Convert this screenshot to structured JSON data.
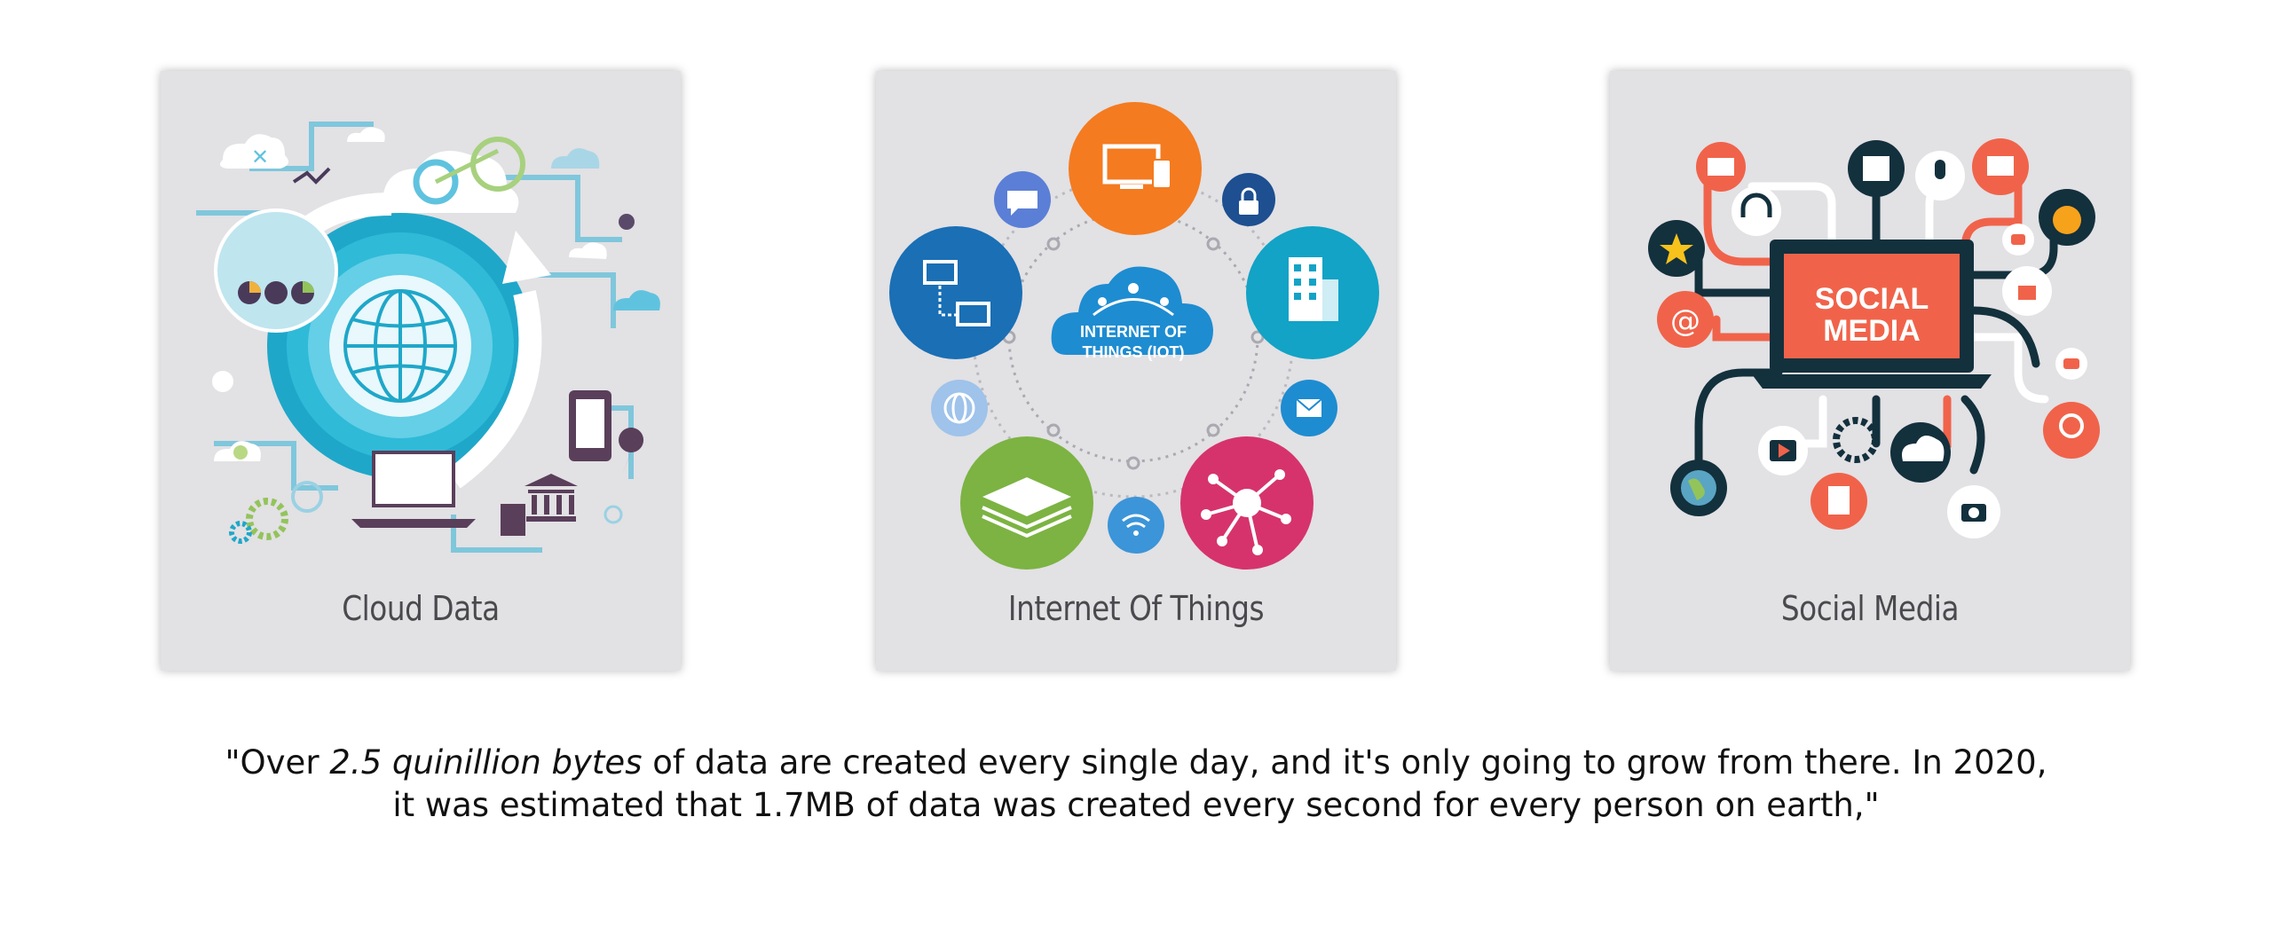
{
  "cards": [
    {
      "label": "Cloud Data",
      "icon": "cloud-data-illustration"
    },
    {
      "label": "Internet Of Things",
      "icon": "iot-illustration",
      "center_text_1": "INTERNET OF",
      "center_text_2": "THINGS (IOT)"
    },
    {
      "label": "Social Media",
      "icon": "social-media-illustration",
      "screen_text_1": "SOCIAL",
      "screen_text_2": "MEDIA"
    }
  ],
  "quote": {
    "open": "\"Over ",
    "emphasis": "2.5 quinillion bytes",
    "line1_rest": " of data are created every single day, and it's only going to grow from there. In 2020,",
    "line2": "it was estimated that 1.7MB of data was created every second for every person on earth,\""
  },
  "colors": {
    "card_bg": "#e2e1e4",
    "iot_orange": "#f47b20",
    "iot_blue": "#1a6fb5",
    "iot_teal": "#12a3c6",
    "iot_green": "#7cb342",
    "iot_pink": "#d6336c",
    "social_coral": "#f0634a",
    "social_navy": "#13303d"
  }
}
